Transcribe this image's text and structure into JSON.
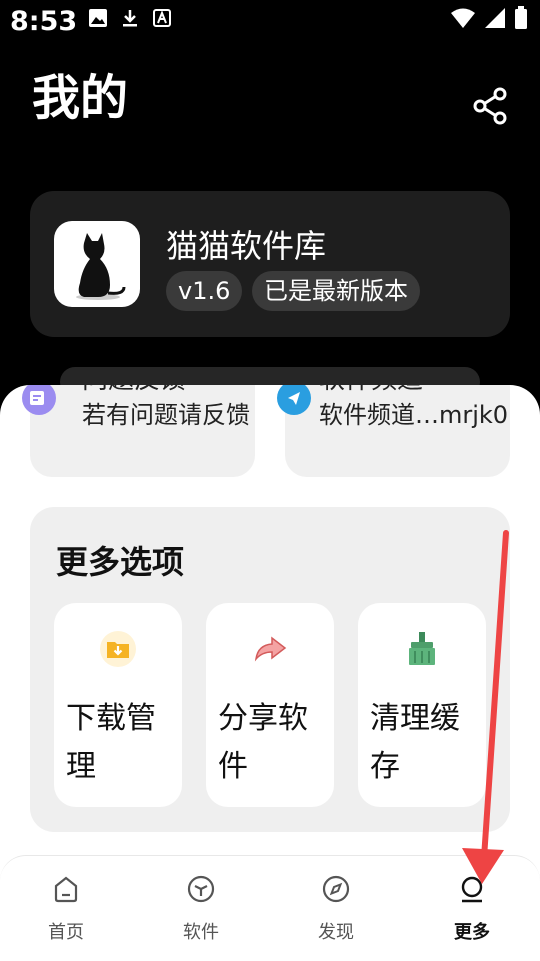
{
  "status_bar": {
    "time": "8:53"
  },
  "header": {
    "title": "我的"
  },
  "app_info": {
    "name": "猫猫软件库",
    "version": "v1.6",
    "update_status": "已是最新版本"
  },
  "quick_cards": [
    {
      "title": "问题反馈",
      "subtitle": "若有问题请反馈"
    },
    {
      "title": "软件频道",
      "subtitle": "软件频道…mrjk0"
    }
  ],
  "more_options": {
    "title": "更多选项",
    "items": [
      {
        "label": "下载管理"
      },
      {
        "label": "分享软件"
      },
      {
        "label": "清理缓存"
      }
    ]
  },
  "bottom_nav": {
    "items": [
      {
        "label": "首页"
      },
      {
        "label": "软件"
      },
      {
        "label": "发现"
      },
      {
        "label": "更多"
      }
    ],
    "active_index": 3
  },
  "colors": {
    "accent_red": "#ee4444",
    "card_dark": "#1e1e1e"
  }
}
